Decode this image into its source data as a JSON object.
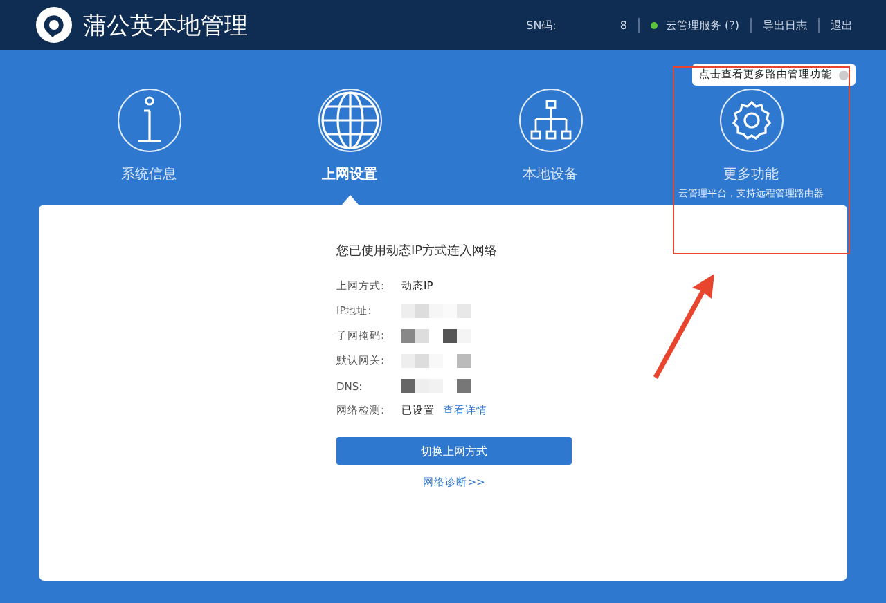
{
  "header": {
    "title": "蒲公英本地管理",
    "sn_label": "SN码:",
    "sn_value": "8",
    "cloud_service": {
      "label": "云管理服务 (?)",
      "online": true
    },
    "links": [
      "导出日志",
      "退出"
    ]
  },
  "nav": [
    {
      "label": "系统信息",
      "selected": false
    },
    {
      "label": "上网设置",
      "selected": true
    },
    {
      "label": "本地设备",
      "selected": false
    },
    {
      "label": "更多功能",
      "selected": false,
      "subtitle": "云管理平台，支持远程管理路由器"
    }
  ],
  "tooltip": {
    "text": "点击查看更多路由管理功能"
  },
  "card": {
    "heading": "您已使用动态IP方式连入网络",
    "rows": [
      {
        "label": "上网方式:",
        "kind": "text",
        "value": "动态IP"
      },
      {
        "label": "IP地址:",
        "kind": "redacted"
      },
      {
        "label": "子网掩码:",
        "kind": "redacted"
      },
      {
        "label": "默认网关:",
        "kind": "redacted"
      },
      {
        "label": "DNS:",
        "kind": "redacted"
      },
      {
        "label": "网络检测:",
        "kind": "link",
        "value": "已设置",
        "link": "查看详情"
      }
    ],
    "button": "切换上网方式",
    "diagnose_link": "网络诊断>>"
  }
}
